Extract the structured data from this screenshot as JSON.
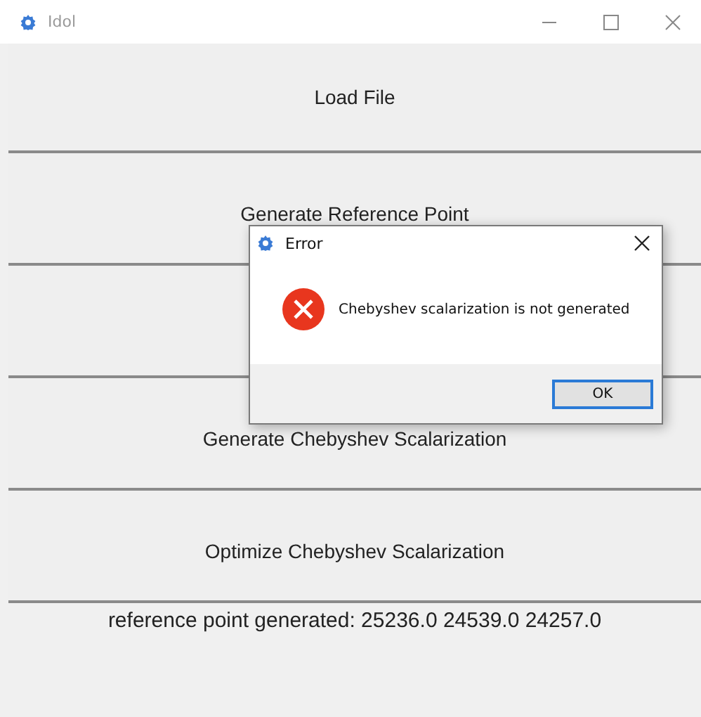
{
  "window": {
    "title": "Idol"
  },
  "buttons": [
    {
      "kind": "labeled",
      "label": "Load File"
    },
    {
      "kind": "labeled",
      "label": "Generate Reference Point"
    },
    {
      "kind": "blank"
    },
    {
      "kind": "labeled",
      "label": "Generate Chebyshev Scalarization"
    },
    {
      "kind": "labeled",
      "label": "Optimize Chebyshev Scalarization"
    }
  ],
  "status_text": "reference point generated: 25236.0 24539.0 24257.0",
  "dialog": {
    "title": "Error",
    "message": "Chebyshev scalarization is not generated",
    "button": "OK"
  }
}
